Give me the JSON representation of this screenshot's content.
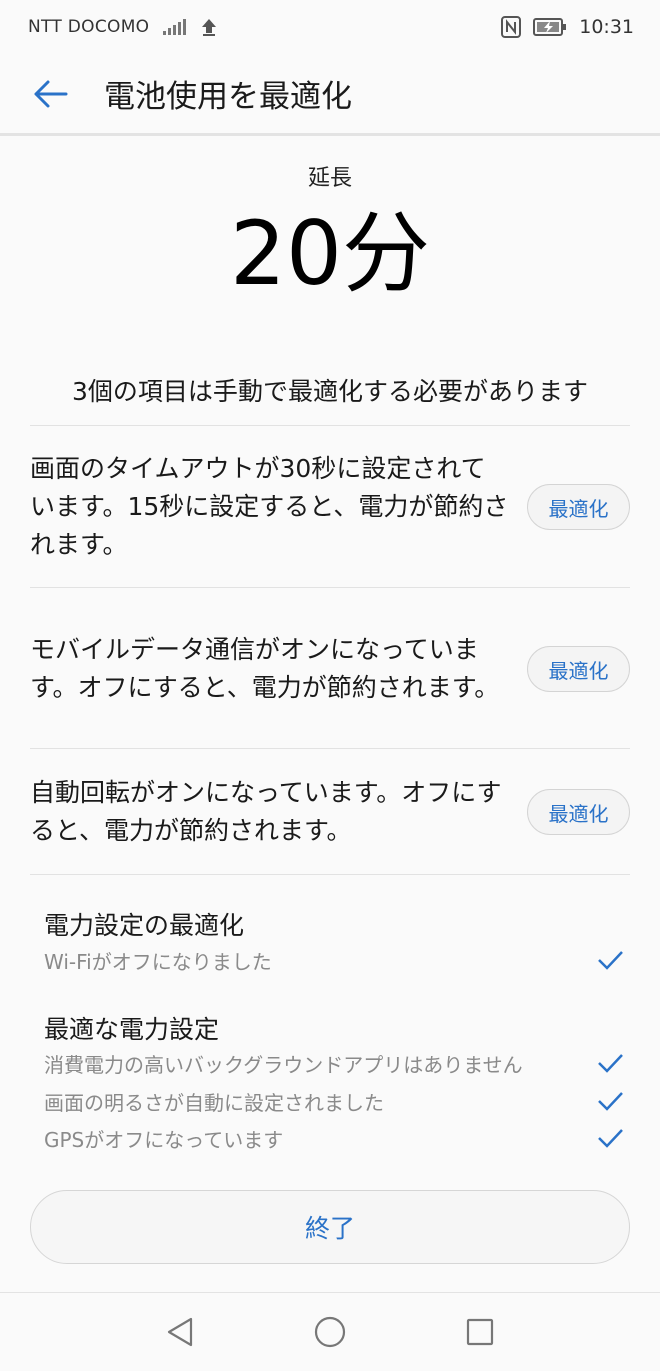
{
  "status_bar": {
    "carrier": "NTT DOCOMO",
    "time": "10:31",
    "icons": [
      "signal-icon",
      "upload-icon",
      "nfc-icon",
      "battery-charging-icon"
    ]
  },
  "header": {
    "title": "電池使用を最適化",
    "back_icon": "arrow-left-icon"
  },
  "summary": {
    "label": "延長",
    "value": "20分"
  },
  "manual": {
    "heading": "3個の項目は手動で最適化する必要があります",
    "items": [
      {
        "text": "画面のタイムアウトが30秒に設定されています。15秒に設定すると、電力が節約されます。",
        "button": "最適化"
      },
      {
        "text": "モバイルデータ通信がオンになっています。オフにすると、電力が節約されます。",
        "button": "最適化"
      },
      {
        "text": "自動回転がオンになっています。オフにすると、電力が節約されます。",
        "button": "最適化"
      }
    ]
  },
  "power_settings": {
    "title": "電力設定の最適化",
    "items": [
      {
        "text": "Wi-Fiがオフになりました",
        "icon": "check-icon"
      }
    ]
  },
  "optimal_settings": {
    "title": "最適な電力設定",
    "items": [
      {
        "text": "消費電力の高いバックグラウンドアプリはありません",
        "icon": "check-icon"
      },
      {
        "text": "画面の明るさが自動に設定されました",
        "icon": "check-icon"
      },
      {
        "text": "GPSがオフになっています",
        "icon": "check-icon"
      }
    ]
  },
  "finish_button": "終了",
  "nav": {
    "icons": [
      "back-triangle-icon",
      "home-circle-icon",
      "recents-square-icon"
    ]
  },
  "colors": {
    "accent": "#2a72c8",
    "background": "#fafafa",
    "secondary_text": "#8a8a8a"
  }
}
